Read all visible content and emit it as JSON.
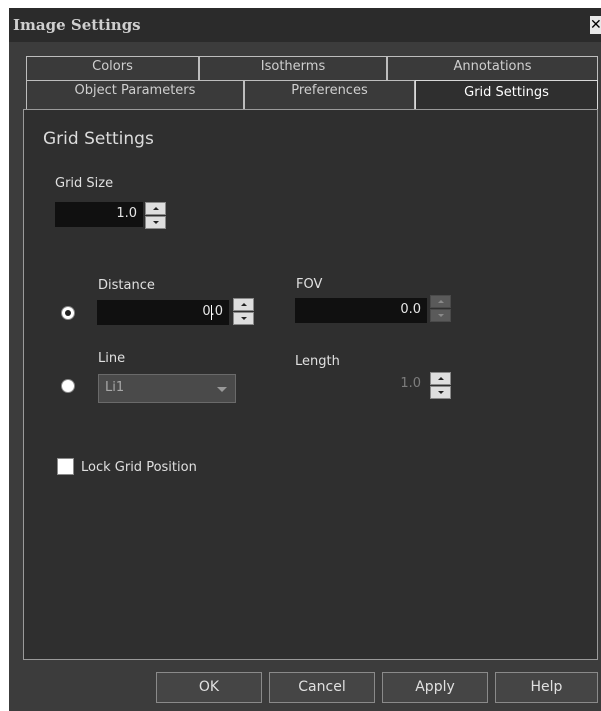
{
  "window": {
    "title": "Image Settings",
    "close_glyph": "✕"
  },
  "tabs": {
    "row1": [
      "Colors",
      "Isotherms",
      "Annotations"
    ],
    "row2": [
      "Object Parameters",
      "Preferences",
      "Grid Settings"
    ],
    "active": "Grid Settings"
  },
  "panel": {
    "heading": "Grid Settings",
    "grid_size": {
      "label": "Grid Size",
      "value": "1.0"
    },
    "distance": {
      "label": "Distance",
      "value": "0.0",
      "checked": true
    },
    "fov": {
      "label": "FOV",
      "value": "0.0"
    },
    "line": {
      "label": "Line",
      "selected": "Li1",
      "checked": false
    },
    "length": {
      "label": "Length",
      "value": "1.0"
    },
    "lock": {
      "label": "Lock Grid Position",
      "checked": false
    }
  },
  "buttons": {
    "ok": "OK",
    "cancel": "Cancel",
    "apply": "Apply",
    "help": "Help"
  }
}
